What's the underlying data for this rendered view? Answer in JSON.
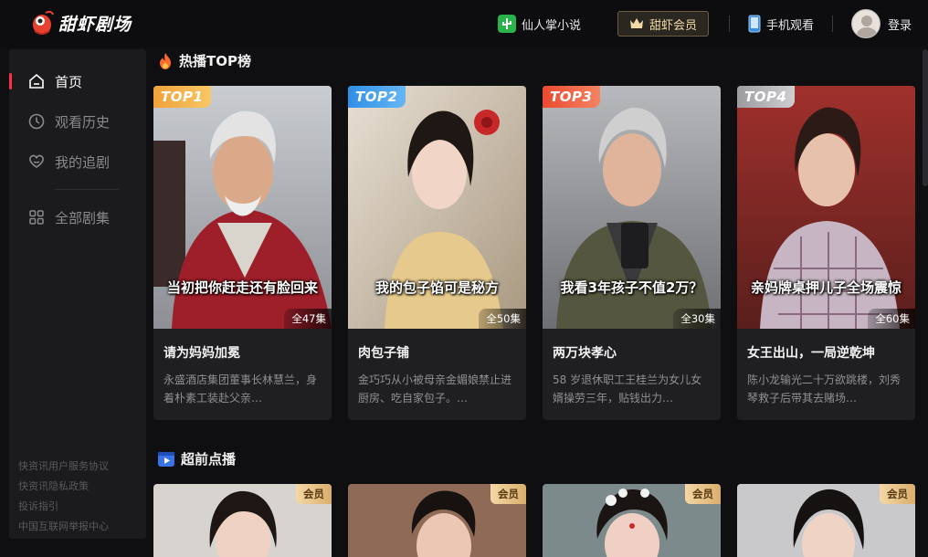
{
  "app": {
    "name": "甜虾剧场"
  },
  "header": {
    "novel_link": "仙人掌小说",
    "vip_button": "甜虾会员",
    "mobile_link": "手机观看",
    "login": "登录"
  },
  "sidebar": {
    "items": [
      {
        "label": "首页",
        "icon": "home-icon",
        "active": true
      },
      {
        "label": "观看历史",
        "icon": "clock-icon"
      },
      {
        "label": "我的追剧",
        "icon": "heart-icon"
      },
      {
        "label": "全部剧集",
        "icon": "grid-icon"
      }
    ],
    "footer": [
      "快资讯用户服务协议",
      "快资讯隐私政策",
      "投诉指引",
      "中国互联网举报中心"
    ]
  },
  "sections": {
    "top": {
      "title": "热播TOP榜",
      "cards": [
        {
          "rank": "TOP1",
          "rank_color": "#f3a93b",
          "caption": "当初把你赶走还有脸回来",
          "episodes": "全47集",
          "title": "请为妈妈加冕",
          "desc": "永盛酒店集团董事长林慧兰，身着朴素工装赴父亲…"
        },
        {
          "rank": "TOP2",
          "rank_color": "#3aa3f0",
          "caption": "我的包子馅可是秘方",
          "episodes": "全50集",
          "title": "肉包子铺",
          "desc": "金巧巧从小被母亲金媚娘禁止进厨房、吃自家包子。…"
        },
        {
          "rank": "TOP3",
          "rank_color": "#f0533a",
          "caption": "我看3年孩子不值2万？",
          "episodes": "全30集",
          "title": "两万块孝心",
          "desc": "58 岁退休职工王桂兰为女儿女婿操劳三年，贴钱出力…"
        },
        {
          "rank": "TOP4",
          "rank_color": "#b9b9bd",
          "caption": "亲妈牌桌押儿子全场震惊",
          "episodes": "全60集",
          "title": "女王出山，一局逆乾坤",
          "desc": "陈小龙输光二十万欲跳楼，刘秀琴救子后带其去赌场…"
        }
      ]
    },
    "preview": {
      "title": "超前点播",
      "cards": [
        {
          "tag": "会员"
        },
        {
          "tag": "会员"
        },
        {
          "tag": "会员"
        },
        {
          "tag": "会员"
        }
      ]
    }
  }
}
